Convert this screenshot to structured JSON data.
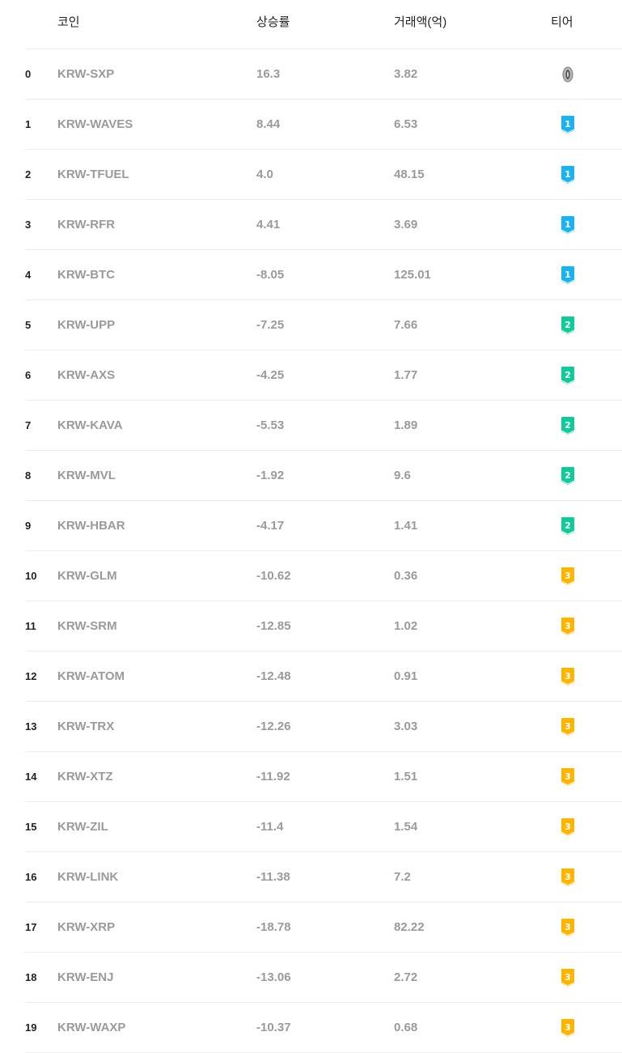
{
  "table": {
    "headers": {
      "coin": "코인",
      "rate": "상승률",
      "volume": "거래액(억)",
      "tier": "티어"
    },
    "rows": [
      {
        "index": "0",
        "coin": "KRW-SXP",
        "rate": "16.3",
        "volume": "3.82",
        "tier": "0",
        "tier_icon": "tier-0-icon",
        "tier_color": "#9e9e9e"
      },
      {
        "index": "1",
        "coin": "KRW-WAVES",
        "rate": "8.44",
        "volume": "6.53",
        "tier": "1",
        "tier_icon": "tier-1-icon",
        "tier_color": "#1ab2f0"
      },
      {
        "index": "2",
        "coin": "KRW-TFUEL",
        "rate": "4.0",
        "volume": "48.15",
        "tier": "1",
        "tier_icon": "tier-1-icon",
        "tier_color": "#1ab2f0"
      },
      {
        "index": "3",
        "coin": "KRW-RFR",
        "rate": "4.41",
        "volume": "3.69",
        "tier": "1",
        "tier_icon": "tier-1-icon",
        "tier_color": "#1ab2f0"
      },
      {
        "index": "4",
        "coin": "KRW-BTC",
        "rate": "-8.05",
        "volume": "125.01",
        "tier": "1",
        "tier_icon": "tier-1-icon",
        "tier_color": "#1ab2f0"
      },
      {
        "index": "5",
        "coin": "KRW-UPP",
        "rate": "-7.25",
        "volume": "7.66",
        "tier": "2",
        "tier_icon": "tier-2-icon",
        "tier_color": "#12c999"
      },
      {
        "index": "6",
        "coin": "KRW-AXS",
        "rate": "-4.25",
        "volume": "1.77",
        "tier": "2",
        "tier_icon": "tier-2-icon",
        "tier_color": "#12c999"
      },
      {
        "index": "7",
        "coin": "KRW-KAVA",
        "rate": "-5.53",
        "volume": "1.89",
        "tier": "2",
        "tier_icon": "tier-2-icon",
        "tier_color": "#12c999"
      },
      {
        "index": "8",
        "coin": "KRW-MVL",
        "rate": "-1.92",
        "volume": "9.6",
        "tier": "2",
        "tier_icon": "tier-2-icon",
        "tier_color": "#12c999"
      },
      {
        "index": "9",
        "coin": "KRW-HBAR",
        "rate": "-4.17",
        "volume": "1.41",
        "tier": "2",
        "tier_icon": "tier-2-icon",
        "tier_color": "#12c999"
      },
      {
        "index": "10",
        "coin": "KRW-GLM",
        "rate": "-10.62",
        "volume": "0.36",
        "tier": "3",
        "tier_icon": "tier-3-icon",
        "tier_color": "#ffb400"
      },
      {
        "index": "11",
        "coin": "KRW-SRM",
        "rate": "-12.85",
        "volume": "1.02",
        "tier": "3",
        "tier_icon": "tier-3-icon",
        "tier_color": "#ffb400"
      },
      {
        "index": "12",
        "coin": "KRW-ATOM",
        "rate": "-12.48",
        "volume": "0.91",
        "tier": "3",
        "tier_icon": "tier-3-icon",
        "tier_color": "#ffb400"
      },
      {
        "index": "13",
        "coin": "KRW-TRX",
        "rate": "-12.26",
        "volume": "3.03",
        "tier": "3",
        "tier_icon": "tier-3-icon",
        "tier_color": "#ffb400"
      },
      {
        "index": "14",
        "coin": "KRW-XTZ",
        "rate": "-11.92",
        "volume": "1.51",
        "tier": "3",
        "tier_icon": "tier-3-icon",
        "tier_color": "#ffb400"
      },
      {
        "index": "15",
        "coin": "KRW-ZIL",
        "rate": "-11.4",
        "volume": "1.54",
        "tier": "3",
        "tier_icon": "tier-3-icon",
        "tier_color": "#ffb400"
      },
      {
        "index": "16",
        "coin": "KRW-LINK",
        "rate": "-11.38",
        "volume": "7.2",
        "tier": "3",
        "tier_icon": "tier-3-icon",
        "tier_color": "#ffb400"
      },
      {
        "index": "17",
        "coin": "KRW-XRP",
        "rate": "-18.78",
        "volume": "82.22",
        "tier": "3",
        "tier_icon": "tier-3-icon",
        "tier_color": "#ffb400"
      },
      {
        "index": "18",
        "coin": "KRW-ENJ",
        "rate": "-13.06",
        "volume": "2.72",
        "tier": "3",
        "tier_icon": "tier-3-icon",
        "tier_color": "#ffb400"
      },
      {
        "index": "19",
        "coin": "KRW-WAXP",
        "rate": "-10.37",
        "volume": "0.68",
        "tier": "3",
        "tier_icon": "tier-3-icon",
        "tier_color": "#ffb400"
      }
    ]
  }
}
